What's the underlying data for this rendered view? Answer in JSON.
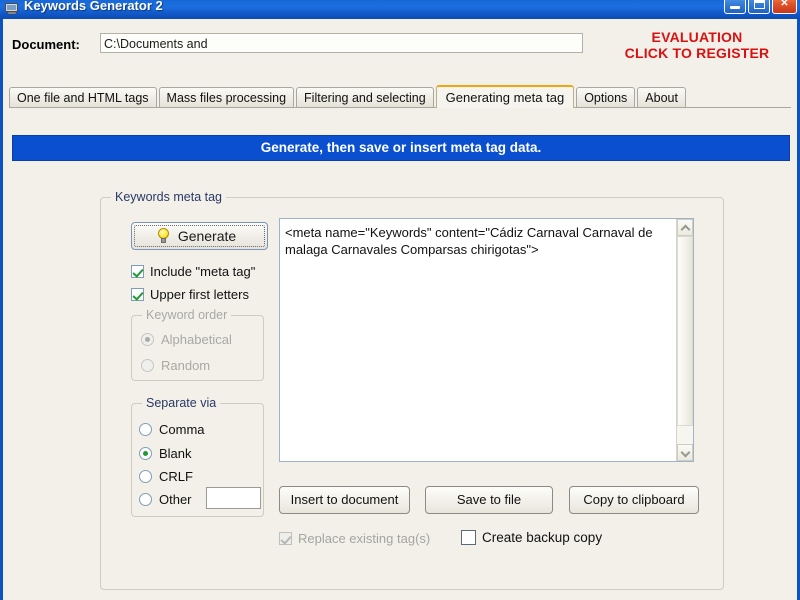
{
  "window": {
    "title": "Keywords Generator 2",
    "icon": "application-window-icon",
    "controls": {
      "minimize": "minimize-button",
      "maximize": "maximize-button",
      "close": "close-button"
    }
  },
  "document_bar": {
    "label": "Document:",
    "value": "C:\\Documents and",
    "placeholder": "",
    "evaluation_line1": "EVALUATION",
    "evaluation_line2": "CLICK TO REGISTER",
    "evaluation_color": "#d81212"
  },
  "tabs": {
    "items": [
      {
        "label": "One file and HTML tags",
        "active": false
      },
      {
        "label": "Mass files processing",
        "active": false
      },
      {
        "label": "Filtering and selecting",
        "active": false
      },
      {
        "label": "Generating meta tag",
        "active": true
      },
      {
        "label": "Options",
        "active": false
      },
      {
        "label": "About",
        "active": false
      }
    ],
    "active_accent": "#f0a60e"
  },
  "banner": {
    "text": "Generate, then save or insert meta tag data.",
    "background": "#0a4fd0",
    "color": "#ffffff"
  },
  "main": {
    "group_title": "Keywords meta tag",
    "generate_button": {
      "label": "Generate",
      "icon": "lightbulb-icon"
    },
    "checkboxes": [
      {
        "label": "Include \"meta tag\"",
        "checked": true,
        "disabled": false
      },
      {
        "label": "Upper first letters",
        "checked": true,
        "disabled": false
      }
    ],
    "keyword_order": {
      "title": "Keyword order",
      "disabled": true,
      "options": [
        {
          "label": "Alphabetical",
          "selected": true
        },
        {
          "label": "Random",
          "selected": false
        }
      ]
    },
    "separate_via": {
      "title": "Separate via",
      "disabled": false,
      "options": [
        {
          "label": "Comma",
          "selected": false
        },
        {
          "label": "Blank",
          "selected": true
        },
        {
          "label": "CRLF",
          "selected": false
        },
        {
          "label": "Other",
          "selected": false
        }
      ],
      "other_value": "",
      "other_placeholder": ""
    },
    "output": {
      "text": "<meta name=\"Keywords\" content=\"Cádiz Carnaval Carnaval de malaga Carnavales Comparsas chirigotas\">",
      "scrollbar": {
        "up_icon": "chevron-up-icon",
        "down_icon": "chevron-down-icon"
      }
    },
    "actions": [
      {
        "label": "Insert to document"
      },
      {
        "label": "Save to file"
      },
      {
        "label": "Copy to clipboard"
      }
    ],
    "bottom_checkboxes": [
      {
        "label": "Replace existing tag(s)",
        "checked": true,
        "disabled": true
      },
      {
        "label": "Create backup copy",
        "checked": false,
        "disabled": false
      }
    ]
  }
}
